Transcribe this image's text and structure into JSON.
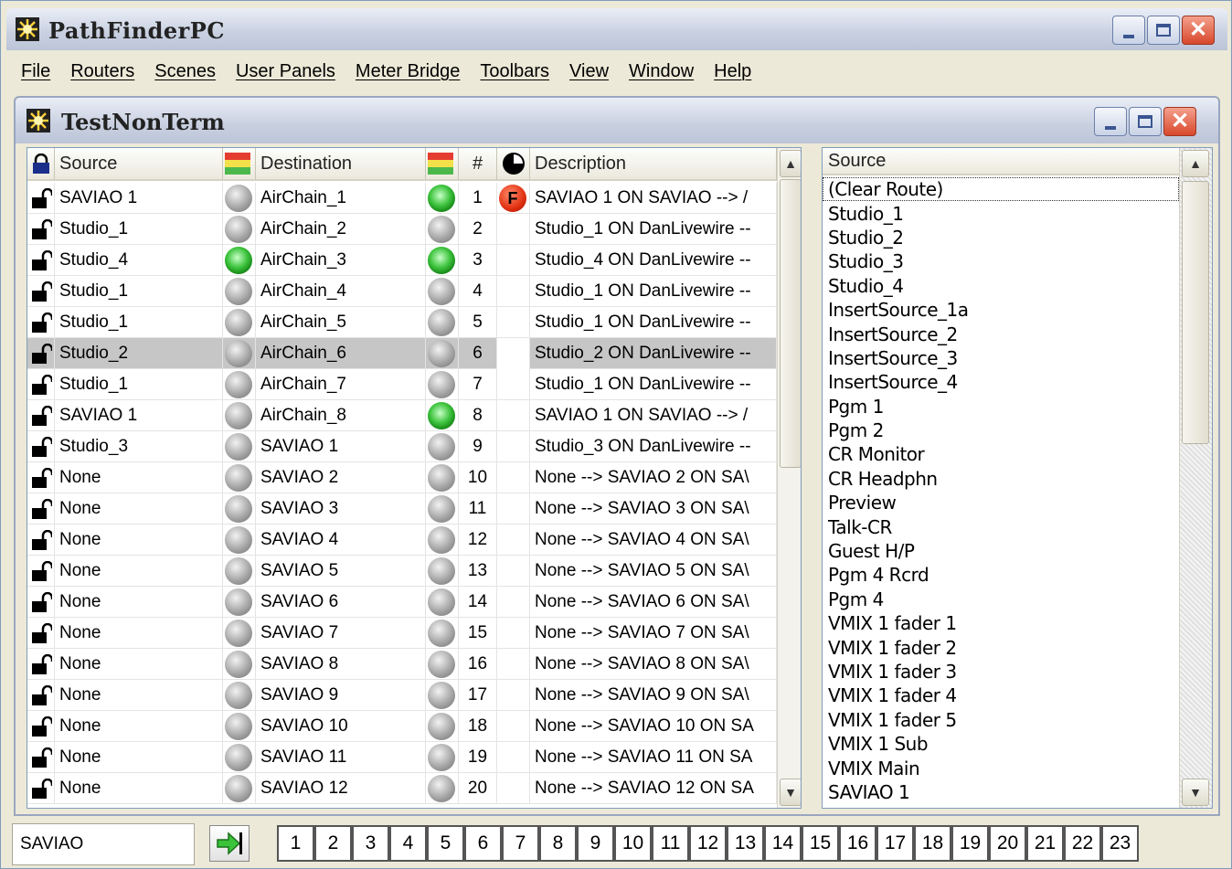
{
  "app": {
    "title": "PathFinderPC"
  },
  "menu": [
    "File",
    "Routers",
    "Scenes",
    "User Panels",
    "Meter Bridge",
    "Toolbars",
    "View",
    "Window",
    "Help"
  ],
  "panel": {
    "title": "TestNonTerm"
  },
  "grid": {
    "headers": {
      "source": "Source",
      "destination": "Destination",
      "num": "#",
      "description": "Description"
    },
    "rows": [
      {
        "source": "SAVIAO 1",
        "src_led": "gray",
        "destination": "AirChain_1",
        "dst_led": "green",
        "num": "1",
        "flag": "F",
        "description": "SAVIAO 1 ON SAVIAO --> /"
      },
      {
        "source": "Studio_1",
        "src_led": "gray",
        "destination": "AirChain_2",
        "dst_led": "gray",
        "num": "2",
        "flag": "",
        "description": "Studio_1 ON DanLivewire --"
      },
      {
        "source": "Studio_4",
        "src_led": "green",
        "destination": "AirChain_3",
        "dst_led": "green",
        "num": "3",
        "flag": "",
        "description": "Studio_4 ON DanLivewire --"
      },
      {
        "source": "Studio_1",
        "src_led": "gray",
        "destination": "AirChain_4",
        "dst_led": "gray",
        "num": "4",
        "flag": "",
        "description": "Studio_1 ON DanLivewire --"
      },
      {
        "source": "Studio_1",
        "src_led": "gray",
        "destination": "AirChain_5",
        "dst_led": "gray",
        "num": "5",
        "flag": "",
        "description": "Studio_1 ON DanLivewire --"
      },
      {
        "source": "Studio_2",
        "src_led": "gray",
        "destination": "AirChain_6",
        "dst_led": "gray",
        "num": "6",
        "flag": "",
        "description": "Studio_2 ON DanLivewire --",
        "selected": true
      },
      {
        "source": "Studio_1",
        "src_led": "gray",
        "destination": "AirChain_7",
        "dst_led": "gray",
        "num": "7",
        "flag": "",
        "description": "Studio_1 ON DanLivewire --"
      },
      {
        "source": "SAVIAO 1",
        "src_led": "gray",
        "destination": "AirChain_8",
        "dst_led": "green",
        "num": "8",
        "flag": "",
        "description": "SAVIAO 1 ON SAVIAO --> /"
      },
      {
        "source": "Studio_3",
        "src_led": "gray",
        "destination": "SAVIAO 1",
        "dst_led": "gray",
        "num": "9",
        "flag": "",
        "description": "Studio_3 ON DanLivewire --"
      },
      {
        "source": "None",
        "src_led": "gray",
        "destination": "SAVIAO 2",
        "dst_led": "gray",
        "num": "10",
        "flag": "",
        "description": "None --> SAVIAO 2 ON SA\\"
      },
      {
        "source": "None",
        "src_led": "gray",
        "destination": "SAVIAO 3",
        "dst_led": "gray",
        "num": "11",
        "flag": "",
        "description": "None --> SAVIAO 3 ON SA\\"
      },
      {
        "source": "None",
        "src_led": "gray",
        "destination": "SAVIAO 4",
        "dst_led": "gray",
        "num": "12",
        "flag": "",
        "description": "None --> SAVIAO 4 ON SA\\"
      },
      {
        "source": "None",
        "src_led": "gray",
        "destination": "SAVIAO 5",
        "dst_led": "gray",
        "num": "13",
        "flag": "",
        "description": "None --> SAVIAO 5 ON SA\\"
      },
      {
        "source": "None",
        "src_led": "gray",
        "destination": "SAVIAO 6",
        "dst_led": "gray",
        "num": "14",
        "flag": "",
        "description": "None --> SAVIAO 6 ON SA\\"
      },
      {
        "source": "None",
        "src_led": "gray",
        "destination": "SAVIAO 7",
        "dst_led": "gray",
        "num": "15",
        "flag": "",
        "description": "None --> SAVIAO 7 ON SA\\"
      },
      {
        "source": "None",
        "src_led": "gray",
        "destination": "SAVIAO 8",
        "dst_led": "gray",
        "num": "16",
        "flag": "",
        "description": "None --> SAVIAO 8 ON SA\\"
      },
      {
        "source": "None",
        "src_led": "gray",
        "destination": "SAVIAO 9",
        "dst_led": "gray",
        "num": "17",
        "flag": "",
        "description": "None --> SAVIAO 9 ON SA\\"
      },
      {
        "source": "None",
        "src_led": "gray",
        "destination": "SAVIAO 10",
        "dst_led": "gray",
        "num": "18",
        "flag": "",
        "description": "None --> SAVIAO 10 ON SA"
      },
      {
        "source": "None",
        "src_led": "gray",
        "destination": "SAVIAO 11",
        "dst_led": "gray",
        "num": "19",
        "flag": "",
        "description": "None --> SAVIAO 11 ON SA"
      },
      {
        "source": "None",
        "src_led": "gray",
        "destination": "SAVIAO 12",
        "dst_led": "gray",
        "num": "20",
        "flag": "",
        "description": "None --> SAVIAO 12 ON SA"
      }
    ]
  },
  "source_list": {
    "header": "Source",
    "items": [
      "(Clear Route)",
      "Studio_1",
      "Studio_2",
      "Studio_3",
      "Studio_4",
      "InsertSource_1a",
      "InsertSource_2",
      "InsertSource_3",
      "InsertSource_4",
      "Pgm 1",
      "Pgm 2",
      "CR Monitor",
      "CR Headphn",
      "Preview",
      "Talk-CR",
      "Guest H/P",
      "Pgm 4 Rcrd",
      "Pgm 4",
      "VMIX 1 fader 1",
      "VMIX 1 fader 2",
      "VMIX 1 fader 3",
      "VMIX 1 fader 4",
      "VMIX 1 fader 5",
      "VMIX 1 Sub",
      "VMIX Main",
      "SAVIAO 1"
    ]
  },
  "status": {
    "panel_name": "SAVIAO",
    "pages": [
      "1",
      "2",
      "3",
      "4",
      "5",
      "6",
      "7",
      "8",
      "9",
      "10",
      "11",
      "12",
      "13",
      "14",
      "15",
      "16",
      "17",
      "18",
      "19",
      "20",
      "21",
      "22",
      "23"
    ]
  },
  "colors": {
    "selected_row": "#c6c6c6",
    "led_green": "#3ec43e",
    "flag_red": "#e03010",
    "titlebar": "#c8d0e0"
  }
}
